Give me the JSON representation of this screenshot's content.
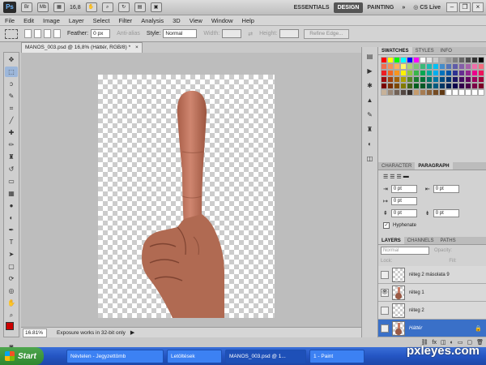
{
  "titlebar": {
    "app_logo": "Ps",
    "zoom": "16,8",
    "workspaces": [
      {
        "label": "ESSENTIALS",
        "active": false
      },
      {
        "label": "DESIGN",
        "active": true
      },
      {
        "label": "PAINTING",
        "active": false
      }
    ],
    "more": "»",
    "cslive": "CS Live"
  },
  "menu": [
    "File",
    "Edit",
    "Image",
    "Layer",
    "Select",
    "Filter",
    "Analysis",
    "3D",
    "View",
    "Window",
    "Help"
  ],
  "options": {
    "feather_label": "Feather:",
    "feather_value": "0 px",
    "antialias_label": "Anti-alias",
    "style_label": "Style:",
    "style_value": "Normal",
    "width_label": "Width:",
    "height_label": "Height:",
    "refine_edge": "Refine Edge..."
  },
  "document": {
    "tab_title": "MANOS_003.psd @ 16,8% (Háttér, RGB/8) *",
    "close": "×"
  },
  "status": {
    "zoom": "16.81%",
    "message": "Exposure works in 32-bit only"
  },
  "tools": [
    {
      "name": "move-tool-icon",
      "glyph": "✥"
    },
    {
      "name": "marquee-tool-icon",
      "glyph": "⬚",
      "selected": true
    },
    {
      "name": "lasso-tool-icon",
      "glyph": "ↄ"
    },
    {
      "name": "quick-select-tool-icon",
      "glyph": "✎"
    },
    {
      "name": "crop-tool-icon",
      "glyph": "⌗"
    },
    {
      "name": "eyedropper-tool-icon",
      "glyph": "╱"
    },
    {
      "name": "healing-brush-tool-icon",
      "glyph": "✚"
    },
    {
      "name": "brush-tool-icon",
      "glyph": "✏"
    },
    {
      "name": "clone-stamp-tool-icon",
      "glyph": "♜"
    },
    {
      "name": "history-brush-tool-icon",
      "glyph": "↺"
    },
    {
      "name": "eraser-tool-icon",
      "glyph": "▭"
    },
    {
      "name": "gradient-tool-icon",
      "glyph": "▦"
    },
    {
      "name": "blur-tool-icon",
      "glyph": "●"
    },
    {
      "name": "dodge-tool-icon",
      "glyph": "◐"
    },
    {
      "name": "pen-tool-icon",
      "glyph": "✒"
    },
    {
      "name": "type-tool-icon",
      "glyph": "T"
    },
    {
      "name": "path-select-tool-icon",
      "glyph": "➤"
    },
    {
      "name": "shape-tool-icon",
      "glyph": "▢"
    },
    {
      "name": "3d-rotate-tool-icon",
      "glyph": "⟳"
    },
    {
      "name": "3d-orbit-tool-icon",
      "glyph": "◎"
    },
    {
      "name": "hand-tool-icon",
      "glyph": "✋"
    },
    {
      "name": "zoom-tool-icon",
      "glyph": "⌕"
    }
  ],
  "colors": {
    "foreground": "#cc0000",
    "background": "#ffffff",
    "skin": "#c87a63",
    "skin_dark": "#9a5a45",
    "highlight": "#3a70c8"
  },
  "panels": {
    "swatch_tabs": [
      {
        "label": "SWATCHES",
        "active": true
      },
      {
        "label": "STYLES",
        "active": false
      },
      {
        "label": "INFO",
        "active": false
      }
    ],
    "swatches": [
      "#ff0000",
      "#ffff00",
      "#00ff00",
      "#00ffff",
      "#0000ff",
      "#ff00ff",
      "#ffffff",
      "#e6e6e6",
      "#cccccc",
      "#b3b3b3",
      "#999999",
      "#808080",
      "#666666",
      "#4d4d4d",
      "#333333",
      "#000000",
      "#f26c4f",
      "#f68e56",
      "#fbaf5d",
      "#fff568",
      "#acd372",
      "#7cc576",
      "#3bb878",
      "#1abbb4",
      "#00bff3",
      "#438ccb",
      "#5574b9",
      "#605ca8",
      "#855fa8",
      "#a763a8",
      "#f06ea9",
      "#f26d7d",
      "#ed1c24",
      "#f26522",
      "#f7941d",
      "#fff200",
      "#8dc63f",
      "#39b54a",
      "#00a651",
      "#00a99d",
      "#00aeef",
      "#0072bc",
      "#0054a6",
      "#2e3192",
      "#662d91",
      "#92278f",
      "#ec008c",
      "#ed145b",
      "#9e0b0f",
      "#a0410d",
      "#a36209",
      "#aba000",
      "#598527",
      "#1a7b30",
      "#007236",
      "#00746b",
      "#0076a3",
      "#004b80",
      "#003471",
      "#1b1464",
      "#440e62",
      "#630460",
      "#9e005d",
      "#9e0039",
      "#790000",
      "#7b2e00",
      "#7d4900",
      "#827b00",
      "#406618",
      "#005e20",
      "#005826",
      "#005952",
      "#005b7f",
      "#003663",
      "#002157",
      "#0d004c",
      "#32004b",
      "#4b0049",
      "#7b0046",
      "#7a0026",
      "#c7b299",
      "#998675",
      "#736357",
      "#534741",
      "#37302d",
      "#c69c6d",
      "#a67c52",
      "#8c6239",
      "#754c24",
      "#603913",
      "#ffffff",
      "#ffffff",
      "#ffffff",
      "#ffffff",
      "#ffffff",
      "#ffffff"
    ],
    "char_tabs": [
      {
        "label": "CHARACTER",
        "active": false
      },
      {
        "label": "PARAGRAPH",
        "active": true
      }
    ],
    "para_fields": [
      "0 pt",
      "0 pt",
      "0 pt",
      "0 pt",
      "0 pt"
    ],
    "hyphenate": "Hyphenate",
    "layer_tabs": [
      {
        "label": "LAYERS",
        "active": true
      },
      {
        "label": "CHANNELS",
        "active": false
      },
      {
        "label": "PATHS",
        "active": false
      }
    ],
    "blend_mode": "Normal",
    "opacity_label": "Opacity:",
    "lock_label": "Lock:",
    "fill_label": "Fill:",
    "layers": [
      {
        "name": "réteg 2 másolata 9",
        "visible": false,
        "active": false,
        "kind": "blank"
      },
      {
        "name": "réteg 1",
        "visible": true,
        "active": false,
        "kind": "hand"
      },
      {
        "name": "réteg 2",
        "visible": false,
        "active": false,
        "kind": "blank"
      },
      {
        "name": "Háttér",
        "visible": false,
        "active": true,
        "kind": "hand"
      }
    ]
  },
  "taskbar": {
    "start": "Start",
    "tasks": [
      {
        "label": "Névtelen - Jegyzettömb",
        "active": false
      },
      {
        "label": "Letöltések",
        "active": false
      },
      {
        "label": "MANOS_003.psd @ 1...",
        "active": true
      },
      {
        "label": "1 - Paint",
        "active": false
      }
    ],
    "watermark": "pxleyes.com"
  }
}
